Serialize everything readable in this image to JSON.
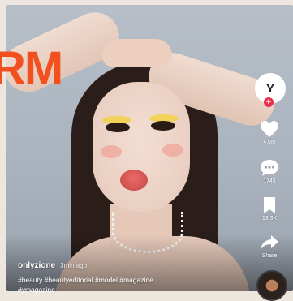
{
  "brand": {
    "text": "RM",
    "color": "#f2501f"
  },
  "rail": {
    "avatar_letter": "Y",
    "follow_symbol": "+",
    "like_count": "4.0M",
    "comment_count": "1745",
    "save_count": "13.3K",
    "share_label": "Share"
  },
  "post": {
    "author": "onlyzione",
    "time": "3min ago",
    "caption_line1": "#beauty #beautyeditorial #model #magazine",
    "caption_line2": "#ymagazine"
  },
  "colors": {
    "follow": "#e6304d",
    "text": "#ffffff"
  }
}
